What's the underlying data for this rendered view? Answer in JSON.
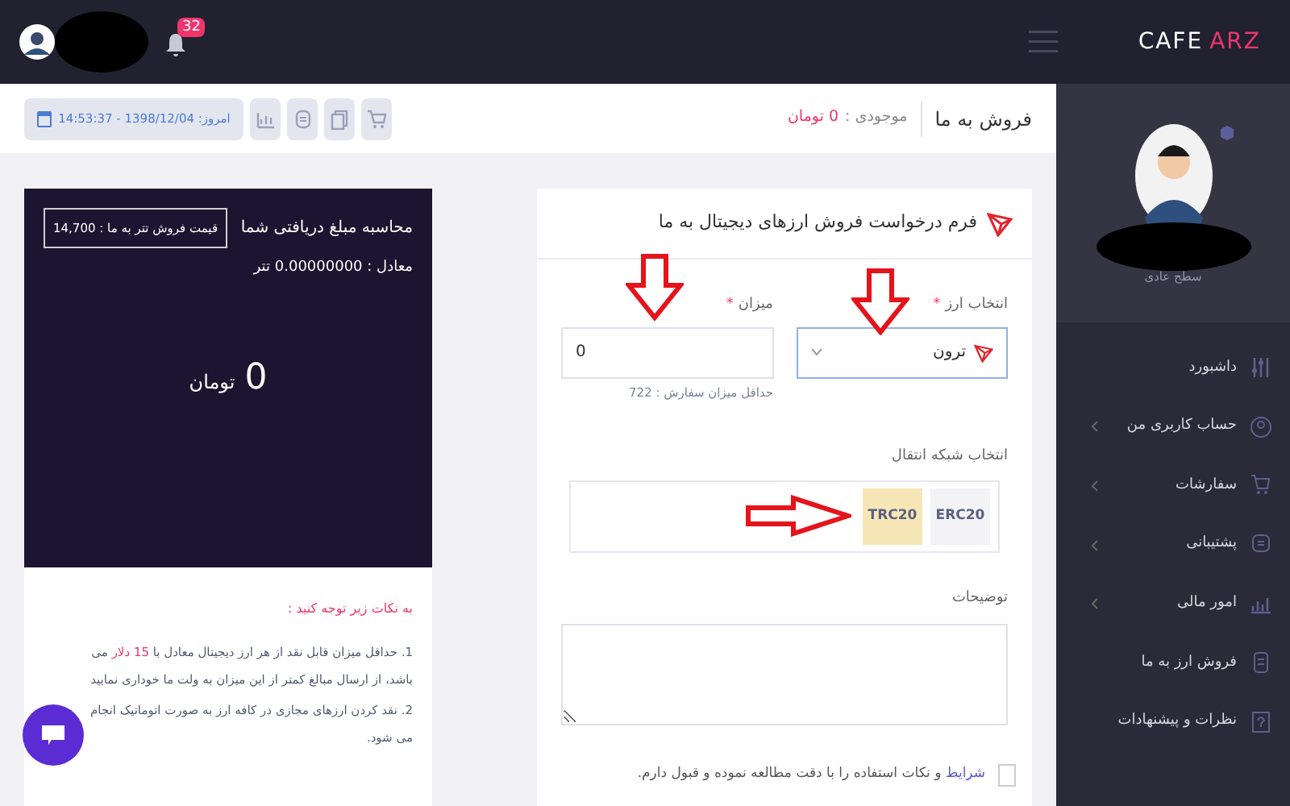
{
  "top_bar": {
    "logo": {
      "first": "CAFE",
      "second": "ARZ"
    },
    "notifications": "32"
  },
  "page_header": {
    "title": "فروش به ما",
    "balance_label": "موجودی :",
    "balance_value": "0 تومان",
    "date": "امروز: 1398/12/04 - 14:53:37"
  },
  "sidebar": {
    "level": "سطح عادی",
    "items": [
      {
        "label": "داشبورد",
        "has_submenu": false
      },
      {
        "label": "حساب کاربری من",
        "has_submenu": true
      },
      {
        "label": "سفارشات",
        "has_submenu": true
      },
      {
        "label": "پشتیبانی",
        "has_submenu": true
      },
      {
        "label": "امور مالی",
        "has_submenu": true
      },
      {
        "label": "فروش ارز به ما",
        "has_submenu": false
      },
      {
        "label": "نظرات و پیشنهادات",
        "has_submenu": false
      }
    ]
  },
  "form": {
    "title": "فرم درخواست فروش ارزهای دیجیتال به ما",
    "currency": {
      "label": "انتخاب ارز",
      "required_mark": "*",
      "value": "ترون"
    },
    "amount": {
      "label": "میزان",
      "required_mark": "*",
      "value": "0",
      "hint": "حداقل میزان سفارش : 722"
    },
    "network": {
      "label": "انتخاب شبکه انتقال",
      "options": [
        {
          "label": "ERC20",
          "selected": false
        },
        {
          "label": "TRC20",
          "selected": true
        }
      ]
    },
    "notes": {
      "label": "توضیحات"
    },
    "terms": {
      "checked": false,
      "link": "شرایط",
      "text": " و نکات استفاده را با دقت مطالعه نموده و قبول دارم."
    }
  },
  "calculator": {
    "title": "محاسبه مبلغ دریافتی شما",
    "price": "قیمت فروش تتر به ما : 14,700",
    "equivalent": "معادل : 0.00000000 تتر",
    "amount": "0",
    "unit": "تومان"
  },
  "tips": {
    "heading": "به نکات زیر توجه کنید :",
    "items": [
      [
        {
          "text": "1. حداقل میزان قابل نقد از هر ارز دیجیتال معادل با ",
          "highlight": false
        },
        {
          "text": "15 دلار",
          "highlight": true
        },
        {
          "text": " می باشد، از ارسال مبالغ کمتر از این میزان به ولت ما خوداری نمایید",
          "highlight": false
        }
      ],
      [
        {
          "text": "2. نقد کردن ارزهای مجازی در کافه ارز به صورت اتوماتیک انجام می شود.",
          "highlight": false
        }
      ]
    ]
  }
}
